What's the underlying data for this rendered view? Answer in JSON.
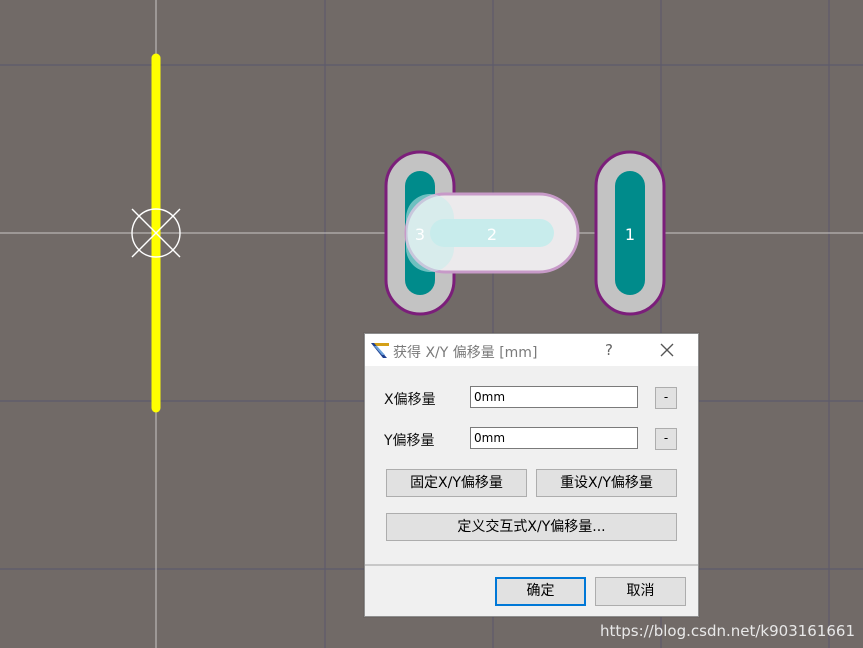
{
  "canvas": {
    "pads": [
      {
        "label": "3"
      },
      {
        "label": "2"
      },
      {
        "label": "1"
      }
    ],
    "colors": {
      "background": "#716a67",
      "grid": "#5f5c6a",
      "trace": "#ffff00",
      "pad_fill": "#008b8b",
      "pad_outline": "#7b1e7a",
      "pad_mask": "#c3c3c3",
      "highlight": "#c8ecec"
    }
  },
  "dialog": {
    "title": "获得 X/Y 偏移量 [mm]",
    "help_label": "?",
    "x_offset": {
      "label": "X偏移量",
      "value": "0mm",
      "button": "-"
    },
    "y_offset": {
      "label": "Y偏移量",
      "value": "0mm",
      "button": "-"
    },
    "fix_button": "固定X/Y偏移量",
    "reset_button": "重设X/Y偏移量",
    "define_button": "定义交互式X/Y偏移量...",
    "ok_button": "确定",
    "cancel_button": "取消"
  },
  "watermark": "https://blog.csdn.net/k903161661"
}
